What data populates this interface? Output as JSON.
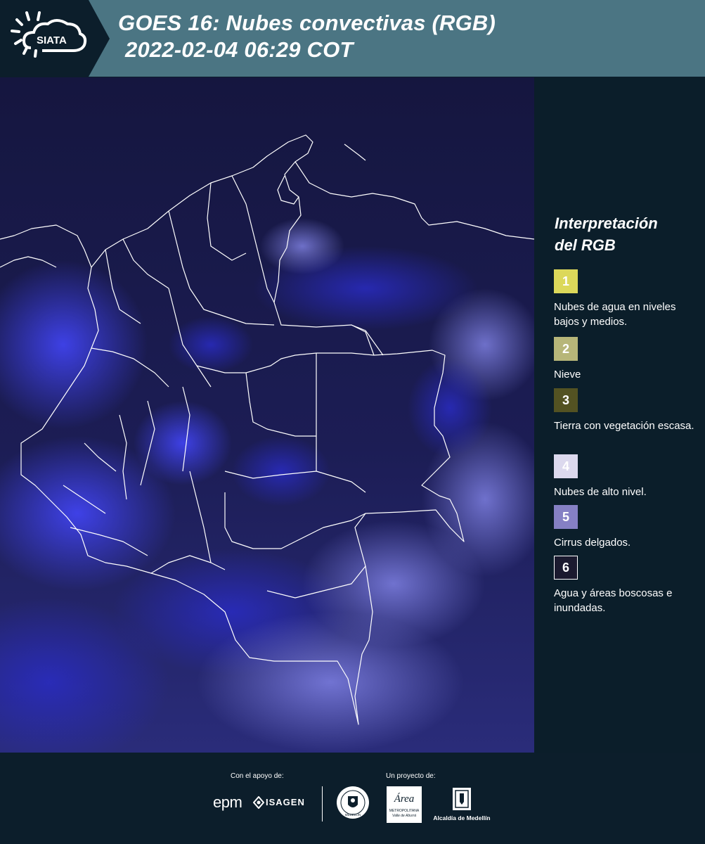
{
  "header": {
    "logo_text": "SIATA",
    "title_line1": "GOES 16: Nubes convectivas (RGB)",
    "title_line2": "2022-02-04 06:29 COT"
  },
  "legend": {
    "title_line1": "Interpretación",
    "title_line2": "del RGB",
    "items": [
      {
        "number": "1",
        "label": "Nubes de agua en niveles bajos y medios.",
        "color": "#dcd85a"
      },
      {
        "number": "2",
        "label": "Nieve",
        "color": "#b7b679"
      },
      {
        "number": "3",
        "label": "Tierra con vegetación escasa.",
        "color": "#535222"
      },
      {
        "number": "4",
        "label": "Nubes de alto nivel.",
        "color": "#dcd9ee"
      },
      {
        "number": "5",
        "label": "Cirrus delgados.",
        "color": "#8580c4"
      },
      {
        "number": "6",
        "label": "Agua y áreas boscosas e inundadas.",
        "color": "#1b1a2f"
      }
    ]
  },
  "footer": {
    "support_label": "Con el apoyo de:",
    "project_label": "Un proyecto de:",
    "sponsors": [
      "epm",
      "ISAGEN"
    ],
    "partners": {
      "area_name": "Área",
      "area_sub1": "METROPOLITANA",
      "area_sub2": "Valle de Aburrá",
      "alcaldia": "Alcaldía de Medellín",
      "seal_text": "MEDELLÍN"
    }
  },
  "colors": {
    "header_bg": "#4b7583",
    "panel_bg": "#0b1e2a",
    "map_base": "#1a1b52",
    "cloud_blue": "#3a3dff",
    "border_lines": "#ffffff"
  }
}
